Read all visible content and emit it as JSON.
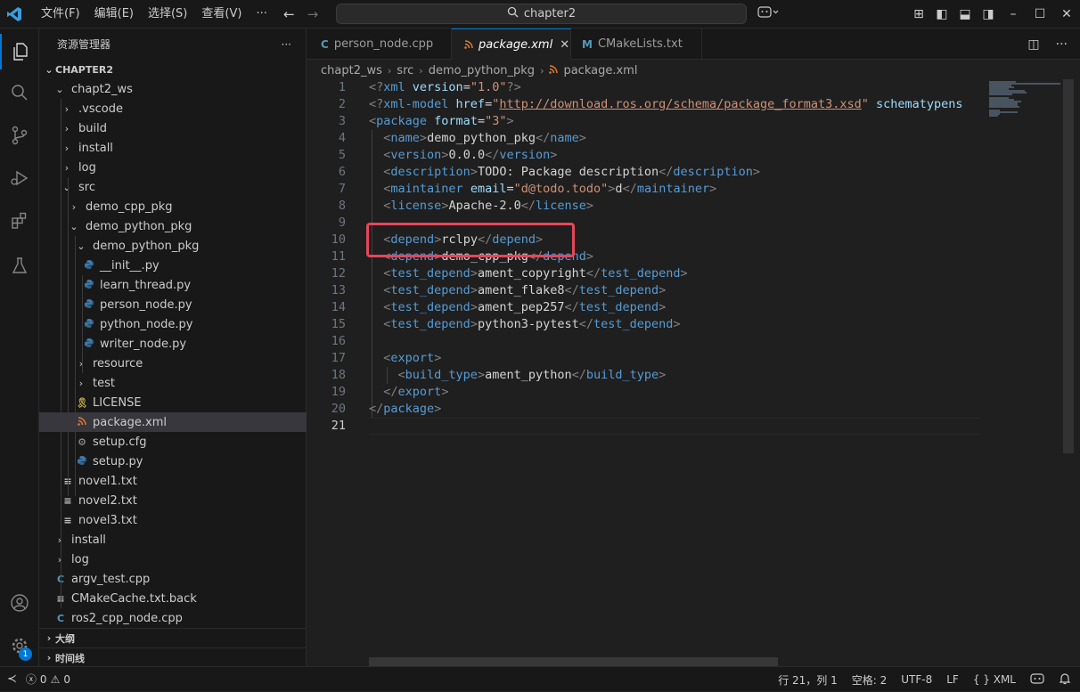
{
  "titlebar": {
    "menu": [
      "文件(F)",
      "编辑(E)",
      "选择(S)",
      "查看(V)",
      "···"
    ],
    "search_text": "chapter2"
  },
  "sidebar": {
    "title": "资源管理器",
    "more": "···",
    "root": "CHAPTER2",
    "items": [
      {
        "label": "chapt2_ws",
        "kind": "folder-open"
      },
      {
        "label": ".vscode",
        "kind": "folder"
      },
      {
        "label": "build",
        "kind": "folder"
      },
      {
        "label": "install",
        "kind": "folder"
      },
      {
        "label": "log",
        "kind": "folder"
      },
      {
        "label": "src",
        "kind": "folder-open"
      },
      {
        "label": "demo_cpp_pkg",
        "kind": "folder"
      },
      {
        "label": "demo_python_pkg",
        "kind": "folder-open"
      },
      {
        "label": "demo_python_pkg",
        "kind": "folder-open"
      },
      {
        "label": "__init__.py",
        "kind": "python"
      },
      {
        "label": "learn_thread.py",
        "kind": "python"
      },
      {
        "label": "person_node.py",
        "kind": "python"
      },
      {
        "label": "python_node.py",
        "kind": "python"
      },
      {
        "label": "writer_node.py",
        "kind": "python"
      },
      {
        "label": "resource",
        "kind": "folder"
      },
      {
        "label": "test",
        "kind": "folder"
      },
      {
        "label": "LICENSE",
        "kind": "license"
      },
      {
        "label": "package.xml",
        "kind": "xml"
      },
      {
        "label": "setup.cfg",
        "kind": "gear"
      },
      {
        "label": "setup.py",
        "kind": "python"
      },
      {
        "label": "novel1.txt",
        "kind": "text"
      },
      {
        "label": "novel2.txt",
        "kind": "text"
      },
      {
        "label": "novel3.txt",
        "kind": "text"
      },
      {
        "label": "install",
        "kind": "folder"
      },
      {
        "label": "log",
        "kind": "folder"
      },
      {
        "label": "argv_test.cpp",
        "kind": "cpp"
      },
      {
        "label": "CMakeCache.txt.back",
        "kind": "text"
      },
      {
        "label": "ros2_cpp_node.cpp",
        "kind": "cpp"
      }
    ],
    "outline": "大纲",
    "timeline": "时间线"
  },
  "tabs": [
    {
      "label": "person_node.cpp",
      "icon": "C"
    },
    {
      "label": "package.xml",
      "icon": "rss"
    },
    {
      "label": "CMakeLists.txt",
      "icon": "M"
    }
  ],
  "breadcrumb": [
    "chapt2_ws",
    "src",
    "demo_python_pkg",
    "package.xml"
  ],
  "line_numbers": [
    "1",
    "2",
    "3",
    "4",
    "5",
    "6",
    "7",
    "8",
    "9",
    "10",
    "11",
    "12",
    "13",
    "14",
    "15",
    "16",
    "17",
    "18",
    "19",
    "20",
    "21"
  ],
  "code": {
    "l1": {
      "a": "<?",
      "b": "xml",
      "c": " version",
      "d": "=",
      "e": "\"1.0\"",
      "f": "?>"
    },
    "l2": {
      "a": "<?",
      "b": "xml-model",
      "c": " href",
      "d": "=",
      "e": "\"",
      "f": "http://download.ros.org/schema/package_format3.xsd",
      "g": "\"",
      "h": " schematypens"
    },
    "l3": {
      "a": "<",
      "b": "package",
      "c": " format",
      "d": "=",
      "e": "\"3\"",
      "f": ">"
    },
    "l4": {
      "open": "name",
      "text": "demo_python_pkg"
    },
    "l5": {
      "open": "version",
      "text": "0.0.0"
    },
    "l6": {
      "open": "description",
      "text": "TODO: Package description"
    },
    "l7": {
      "open": "maintainer",
      "attr": " email",
      "eq": "=",
      "val": "\"d@todo.todo\"",
      "text": "d"
    },
    "l8": {
      "open": "license",
      "text": "Apache-2.0"
    },
    "l10": {
      "open": "depend",
      "text": "rclpy"
    },
    "l11": {
      "open": "depend",
      "text": "demo_cpp_pkg"
    },
    "l12": {
      "open": "test_depend",
      "text": "ament_copyright"
    },
    "l13": {
      "open": "test_depend",
      "text": "ament_flake8"
    },
    "l14": {
      "open": "test_depend",
      "text": "ament_pep257"
    },
    "l15": {
      "open": "test_depend",
      "text": "python3-pytest"
    },
    "l17": {
      "open": "export"
    },
    "l18": {
      "open": "build_type",
      "text": "ament_python"
    },
    "l19": {
      "close": "export"
    },
    "l20": {
      "close": "package"
    }
  },
  "statusbar": {
    "errors": "0",
    "warnings": "0",
    "position": "行 21，列 1",
    "spaces": "空格: 2",
    "encoding": "UTF-8",
    "eol": "LF",
    "language": "XML",
    "lang_icon": "{ }"
  },
  "badge_count": "1"
}
